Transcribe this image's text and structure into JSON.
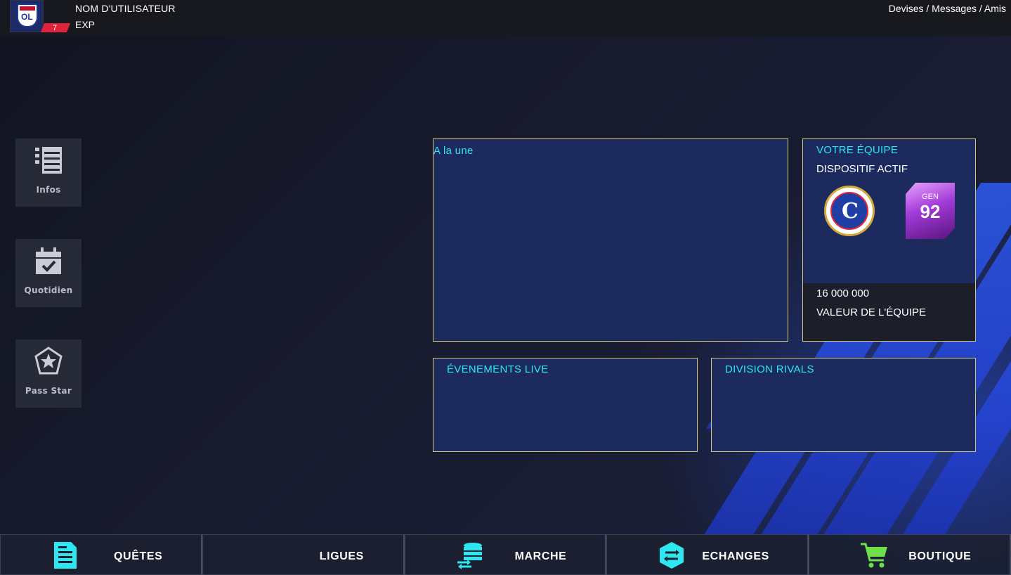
{
  "topbar": {
    "username": "NOM D'UTILISATEUR",
    "exp_label": "EXP",
    "level": "7",
    "links": "Devises / Messages / Amis"
  },
  "sidebar": {
    "items": [
      {
        "label": "Infos",
        "icon": "list-icon"
      },
      {
        "label": "Quotidien",
        "icon": "calendar-check-icon"
      },
      {
        "label": "Pass Star",
        "icon": "star-badge-icon"
      }
    ]
  },
  "panels": {
    "featured": {
      "title": "A la une"
    },
    "team": {
      "title": "VOTRE ÉQUIPE",
      "formation_label": "DISPOSITIF ACTIF",
      "badge_gen_label": "GEN",
      "badge_gen_value": "92",
      "value": "16 000 000",
      "value_label": "VALEUR DE L'ÉQUIPE"
    },
    "live_events": {
      "title": "ÉVENEMENTS LIVE"
    },
    "rivals": {
      "title": "DIVISION RIVALS"
    }
  },
  "bottomnav": {
    "items": [
      {
        "label": "QUÊTES",
        "icon": "document-icon"
      },
      {
        "label": "LIGUES",
        "icon": ""
      },
      {
        "label": "MARCHE",
        "icon": "database-transfer-icon"
      },
      {
        "label": "ECHANGES",
        "icon": "exchange-icon"
      },
      {
        "label": "BOUTIQUE",
        "icon": "cart-icon"
      }
    ]
  },
  "colors": {
    "accent": "#2ee6f0",
    "panel_bg": "#1c2a5e",
    "panel_border": "#d6c877",
    "level_badge": "#e0233a"
  }
}
